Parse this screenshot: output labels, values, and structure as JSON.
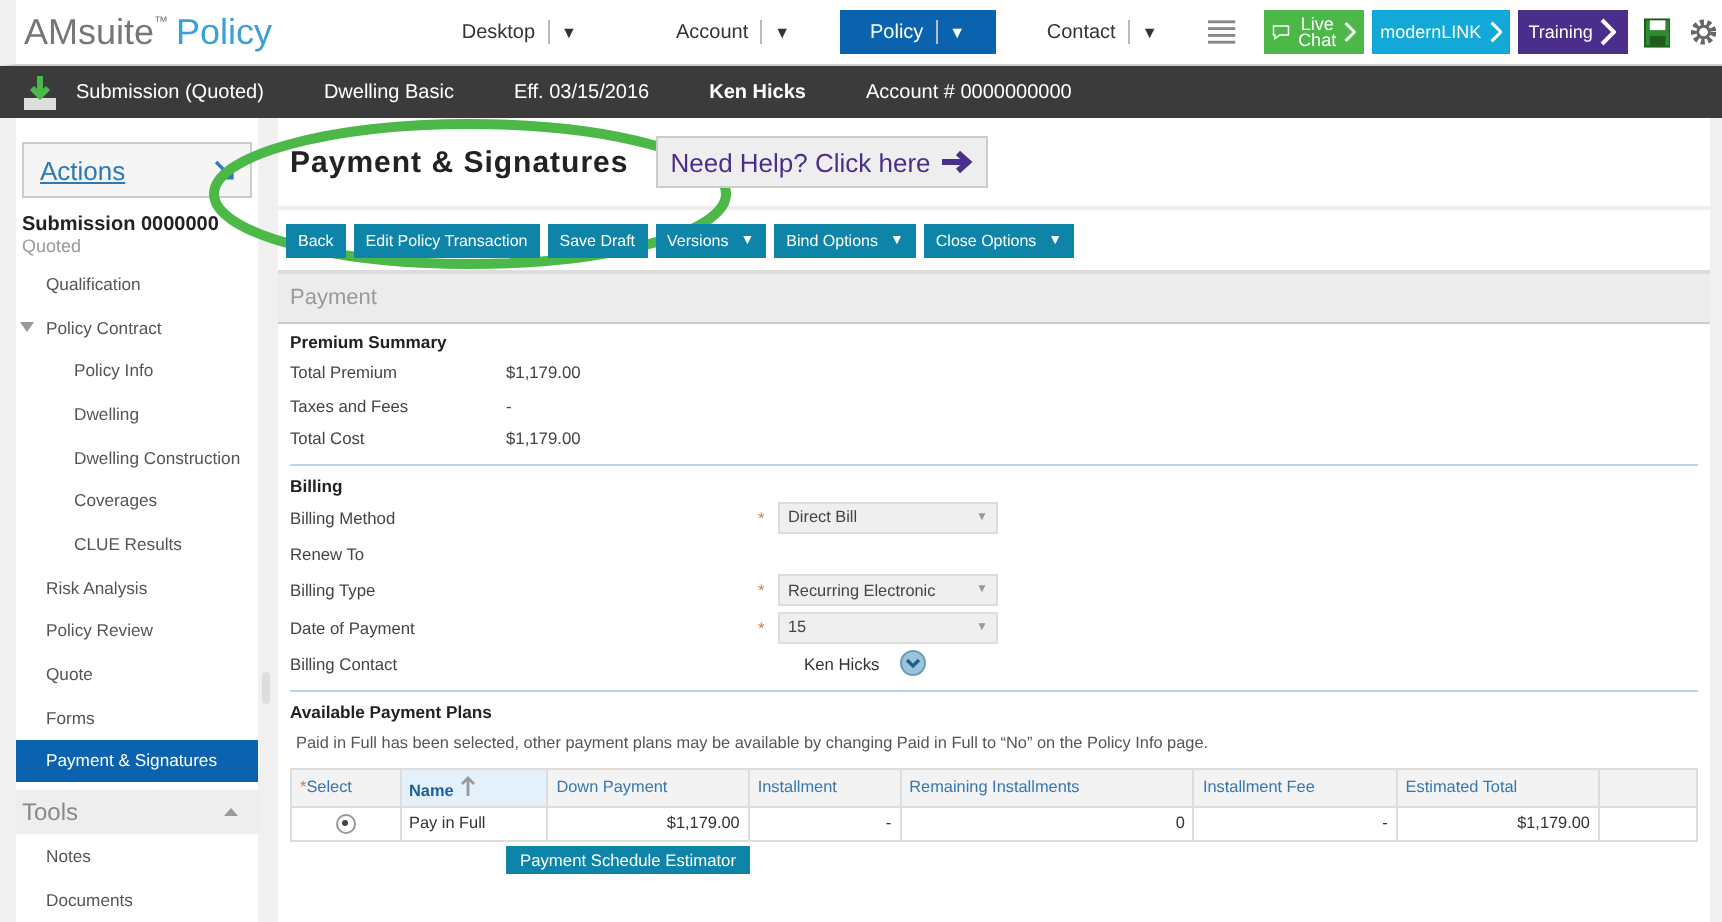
{
  "header": {
    "brand": "AMsuite",
    "trademark": "™",
    "product": "Policy",
    "tabs": [
      {
        "label": "Desktop",
        "selected": false
      },
      {
        "label": "Account",
        "selected": false
      },
      {
        "label": "Policy",
        "selected": true
      },
      {
        "label": "Contact",
        "selected": false
      }
    ],
    "caret": "▼",
    "required_mark": "*",
    "links": [
      {
        "kind": "chat",
        "label": "Live Chat",
        "color": "#4cb848"
      },
      {
        "kind": "link",
        "label": "modernLINK",
        "color": "#12a9d9"
      },
      {
        "kind": "link",
        "label": "Training",
        "color": "#4b2d8c"
      }
    ]
  },
  "info_bar": {
    "status": "Submission (Quoted)",
    "product": "Dwelling Basic",
    "effective": "Eff. 03/15/2016",
    "insured": "Ken Hicks",
    "account": "Account # 0000000000"
  },
  "sidebar": {
    "actions": "Actions",
    "submission": "Submission 0000000",
    "status": "Quoted",
    "items": [
      {
        "label": "Qualification",
        "selected": false
      },
      {
        "label": "Policy Contract",
        "selected": false,
        "expanded": true,
        "children": [
          {
            "label": "Policy Info",
            "selected": false
          },
          {
            "label": "Dwelling",
            "selected": false
          },
          {
            "label": "Dwelling Construction",
            "selected": false
          },
          {
            "label": "Coverages",
            "selected": false
          },
          {
            "label": "CLUE Results",
            "selected": false
          }
        ]
      },
      {
        "label": "Risk Analysis",
        "selected": false
      },
      {
        "label": "Policy Review",
        "selected": false
      },
      {
        "label": "Quote",
        "selected": false
      },
      {
        "label": "Forms",
        "selected": false
      },
      {
        "label": "Payment & Signatures",
        "selected": true
      }
    ],
    "tools": {
      "title": "Tools",
      "items": [
        "Notes",
        "Documents"
      ]
    }
  },
  "page": {
    "title": "Payment & Signatures",
    "help": "Need Help? Click here",
    "toolbar": [
      {
        "label": "Back",
        "dropdown": false
      },
      {
        "label": "Edit Policy Transaction",
        "dropdown": false
      },
      {
        "label": "Save Draft",
        "dropdown": false
      },
      {
        "label": "Versions",
        "dropdown": true
      },
      {
        "label": "Bind Options",
        "dropdown": true
      },
      {
        "label": "Close Options",
        "dropdown": true
      }
    ],
    "section": "Payment",
    "premium": {
      "title": "Premium Summary",
      "rows": [
        {
          "label": "Total Premium",
          "value": "$1,179.00"
        },
        {
          "label": "Taxes and Fees",
          "value": "-"
        },
        {
          "label": "Total Cost",
          "value": "$1,179.00"
        }
      ]
    },
    "billing": {
      "title": "Billing",
      "rows": [
        {
          "kind": "select",
          "label": "Billing Method",
          "required": true,
          "value": "Direct Bill"
        },
        {
          "kind": "empty",
          "label": "Renew To"
        },
        {
          "kind": "select",
          "label": "Billing Type",
          "required": true,
          "value": "Recurring Electronic"
        },
        {
          "kind": "select",
          "label": "Date of Payment",
          "required": true,
          "value": "15"
        },
        {
          "kind": "contact",
          "label": "Billing Contact",
          "value": "Ken Hicks"
        }
      ]
    },
    "plans": {
      "title": "Available Payment Plans",
      "note": "Paid in Full has been selected, other payment plans may be available by changing Paid in Full to “No” on the Policy Info page.",
      "columns": [
        {
          "label": "Select",
          "required": true,
          "sorted": false
        },
        {
          "label": "Name",
          "required": false,
          "sorted": true
        },
        {
          "label": "Down Payment",
          "required": false,
          "sorted": false
        },
        {
          "label": "Installment",
          "required": false,
          "sorted": false
        },
        {
          "label": "Remaining Installments",
          "required": false,
          "sorted": false
        },
        {
          "label": "Installment Fee",
          "required": false,
          "sorted": false
        },
        {
          "label": "Estimated Total",
          "required": false,
          "sorted": false
        }
      ],
      "rows": [
        {
          "selected": true,
          "name": "Pay in Full",
          "down_payment": "$1,179.00",
          "installment": "-",
          "remaining": "0",
          "fee": "-",
          "total": "$1,179.00"
        }
      ],
      "estimator": "Payment Schedule Estimator"
    }
  }
}
